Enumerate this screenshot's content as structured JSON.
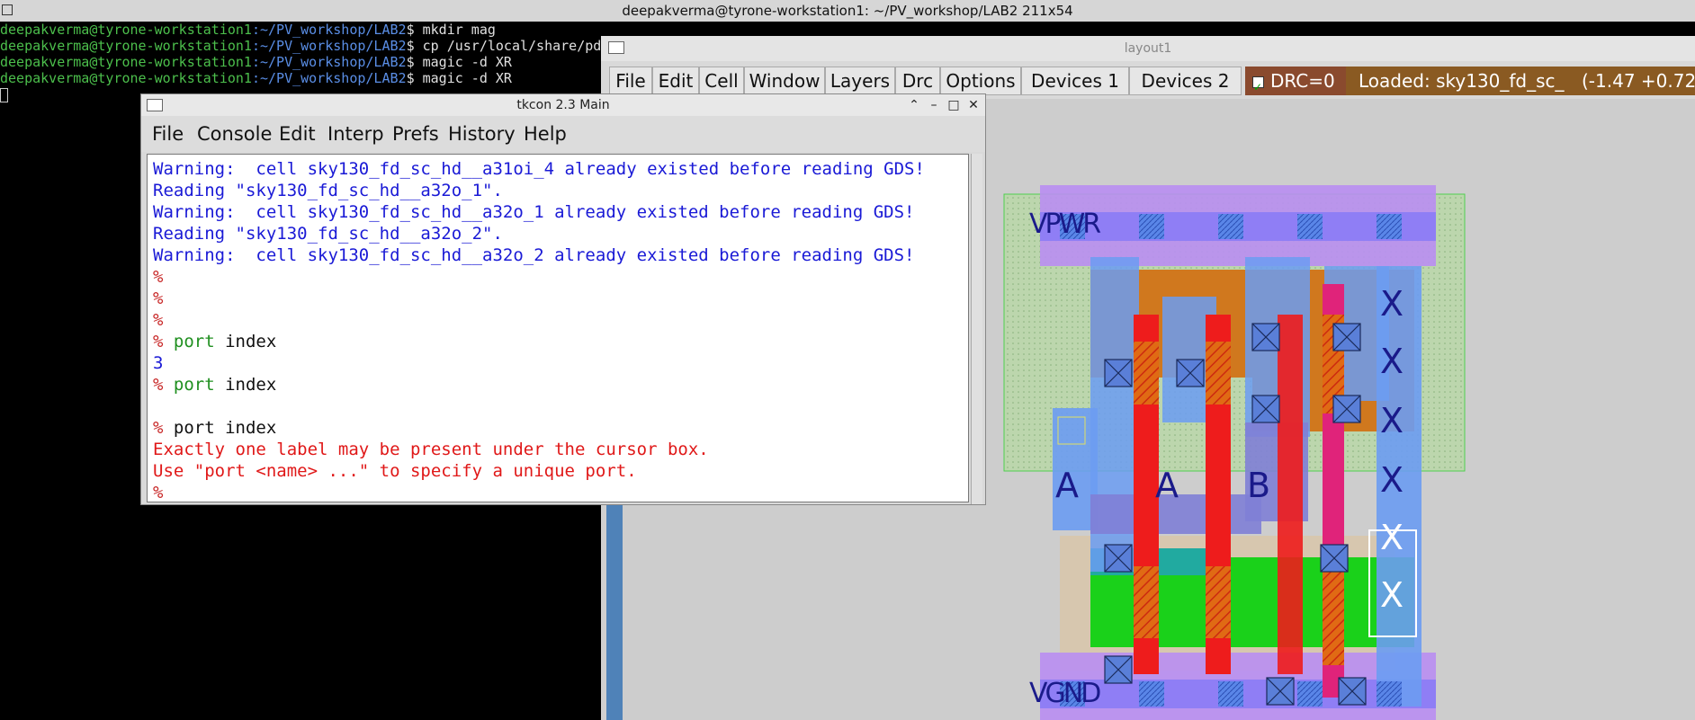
{
  "terminal": {
    "title": "deepakverma@tyrone-workstation1: ~/PV_workshop/LAB2 211x54",
    "lines": [
      {
        "user": "deepakverma@tyrone-workstation1",
        "path": ":~/PV_workshop/LAB2",
        "cmd": "$ mkdir mag"
      },
      {
        "user": "deepakverma@tyrone-workstation1",
        "path": ":~/PV_workshop/LAB2",
        "cmd": "$ cp /usr/local/share/pdk"
      },
      {
        "user": "deepakverma@tyrone-workstation1",
        "path": ":~/PV_workshop/LAB2",
        "cmd": "$ magic -d XR"
      },
      {
        "user": "deepakverma@tyrone-workstation1",
        "path": ":~/PV_workshop/LAB2",
        "cmd": "$ magic -d XR"
      }
    ]
  },
  "layout": {
    "title": "layout1",
    "menus": [
      "File",
      "Edit",
      "Cell",
      "Window",
      "Layers",
      "Drc",
      "Options",
      "Devices 1",
      "Devices 2"
    ],
    "drc_label": "DRC=0",
    "loaded_text": "Loaded: sky130_fd_sc_",
    "coords_text": "(-1.47 +0.72",
    "labels": {
      "vpwr": "VPWR",
      "vgnd": "VGND",
      "a1": "A",
      "a2": "A",
      "b": "B",
      "x": "X"
    },
    "colors": {
      "metal1": "#6b9cf2",
      "met1_li": "#9b78f0",
      "poly": "#ee1c1c",
      "ndiff": "#1ad11a",
      "pdiff": "#d0781e",
      "nwell": "#a6d99a",
      "local": "#7f7fd6"
    }
  },
  "tkcon": {
    "title": "tkcon 2.3 Main",
    "menus": [
      "File",
      "Console",
      "Edit",
      "Interp",
      "Prefs",
      "History",
      "Help"
    ],
    "console": [
      {
        "style": "blue",
        "text": "Warning:  cell sky130_fd_sc_hd__a31oi_4 already existed before reading GDS!"
      },
      {
        "style": "blue",
        "text": "Reading \"sky130_fd_sc_hd__a32o_1\"."
      },
      {
        "style": "blue",
        "text": "Warning:  cell sky130_fd_sc_hd__a32o_1 already existed before reading GDS!"
      },
      {
        "style": "blue",
        "text": "Reading \"sky130_fd_sc_hd__a32o_2\"."
      },
      {
        "style": "blue",
        "text": "Warning:  cell sky130_fd_sc_hd__a32o_2 already existed before reading GDS!"
      },
      {
        "style": "prompt",
        "text": "%"
      },
      {
        "style": "prompt",
        "text": "%"
      },
      {
        "style": "prompt",
        "text": "%"
      },
      {
        "style": "cmd-green",
        "prompt": "% ",
        "cmd": "port",
        "arg": " index"
      },
      {
        "style": "blue",
        "text": "3"
      },
      {
        "style": "cmd-green",
        "prompt": "% ",
        "cmd": "port",
        "arg": " index"
      },
      {
        "style": "blank",
        "text": ""
      },
      {
        "style": "cmd-black",
        "prompt": "% ",
        "cmd": "port index"
      },
      {
        "style": "red",
        "text": "Exactly one label may be present under the cursor box."
      },
      {
        "style": "red",
        "text": "Use \"port <name> ...\" to specify a unique port."
      },
      {
        "style": "prompt",
        "text": "%"
      }
    ]
  }
}
